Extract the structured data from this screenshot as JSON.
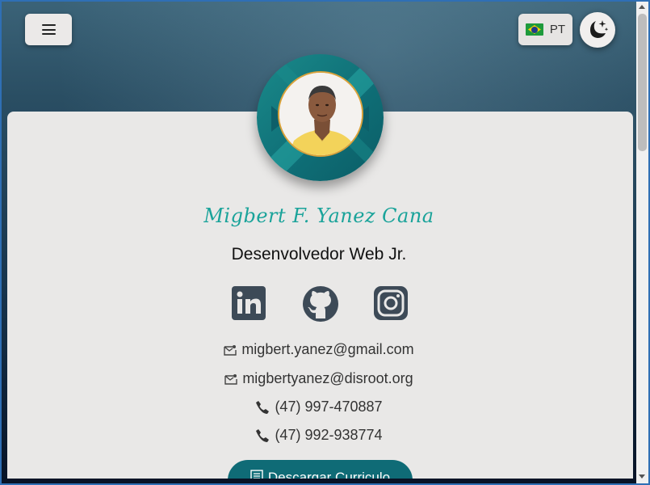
{
  "header": {
    "menu_icon": "hamburger-icon",
    "language": {
      "code": "PT",
      "flag": "brazil-flag-icon"
    },
    "theme_icon": "moon-stars-icon"
  },
  "profile": {
    "name": "Migbert F. Yanez Cana",
    "role": "Desenvolvedor Web Jr.",
    "social": [
      {
        "name": "linkedin",
        "icon": "linkedin-icon"
      },
      {
        "name": "github",
        "icon": "github-icon"
      },
      {
        "name": "instagram",
        "icon": "instagram-icon"
      }
    ],
    "contacts": [
      {
        "type": "email",
        "icon": "mail-icon",
        "value": "migbert.yanez@gmail.com"
      },
      {
        "type": "email",
        "icon": "mail-icon",
        "value": "migbertyanez@disroot.org"
      },
      {
        "type": "phone",
        "icon": "phone-icon",
        "value": "(47) 997-470887"
      },
      {
        "type": "phone",
        "icon": "phone-icon",
        "value": "(47) 992-938774"
      }
    ],
    "cv_button": "Descargar Curriculo"
  },
  "colors": {
    "accent": "#1aa39a",
    "button": "#0f6b76",
    "card": "#e9e8e7"
  }
}
